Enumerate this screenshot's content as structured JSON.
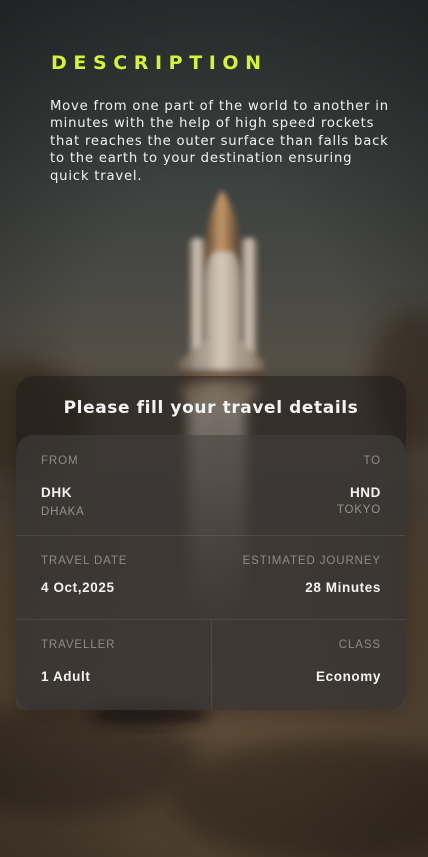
{
  "description": {
    "title": "DESCRIPTION",
    "text": "Move from one part of the world to another in minutes with the help of high speed rockets that reaches the outer surface than falls back to the earth to your destination ensuring quick travel."
  },
  "form": {
    "title": "Please fill your travel details",
    "from": {
      "label": "FROM",
      "code": "DHK",
      "city": "DHAKA"
    },
    "to": {
      "label": "TO",
      "code": "HND",
      "city": "TOKYO"
    },
    "travel_date": {
      "label": "TRAVEL DATE",
      "value": "4 Oct,2025"
    },
    "estimated_journey": {
      "label": "ESTIMATED JOURNEY",
      "value": "28 Minutes"
    },
    "traveller": {
      "label": "TRAVELLER",
      "value": "1 Adult"
    },
    "class": {
      "label": "CLASS",
      "value": "Economy"
    }
  },
  "colors": {
    "accent": "#d6f23b",
    "panel": "#1a1817",
    "text": "#f3f3f3"
  }
}
